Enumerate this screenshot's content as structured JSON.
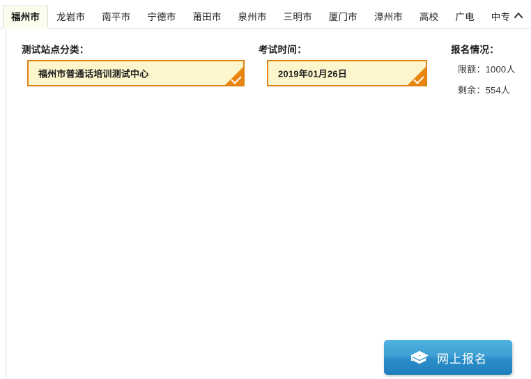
{
  "window": {
    "collapse_icon": "chevron-up-icon"
  },
  "tabs": [
    {
      "label": "福州市",
      "active": true
    },
    {
      "label": "龙岩市",
      "active": false
    },
    {
      "label": "南平市",
      "active": false
    },
    {
      "label": "宁德市",
      "active": false
    },
    {
      "label": "莆田市",
      "active": false
    },
    {
      "label": "泉州市",
      "active": false
    },
    {
      "label": "三明市",
      "active": false
    },
    {
      "label": "厦门市",
      "active": false
    },
    {
      "label": "漳州市",
      "active": false
    },
    {
      "label": "高校",
      "active": false
    },
    {
      "label": "广电",
      "active": false
    },
    {
      "label": "中专",
      "active": false
    }
  ],
  "fields": {
    "station": {
      "label": "测试站点分类：",
      "selected_value": "福州市普通话培训测试中心",
      "selected": true,
      "check_icon": "check-icon"
    },
    "exam_time": {
      "label": "考试时间：",
      "selected_value": "2019年01月26日",
      "selected": true,
      "check_icon": "check-icon"
    }
  },
  "registration": {
    "label": "报名情况：",
    "quota_line": "限额：1000人",
    "remaining_line": "剩余：554人",
    "quota": 1000,
    "remaining": 554
  },
  "action": {
    "signup_label": "网上报名",
    "icon": "graduation-cap-icon"
  },
  "colors": {
    "accent_orange": "#e08214",
    "card_yellow": "#fdf6cd",
    "button_blue": "#2b8ec8",
    "active_tab_bg": "#fdfdef"
  }
}
